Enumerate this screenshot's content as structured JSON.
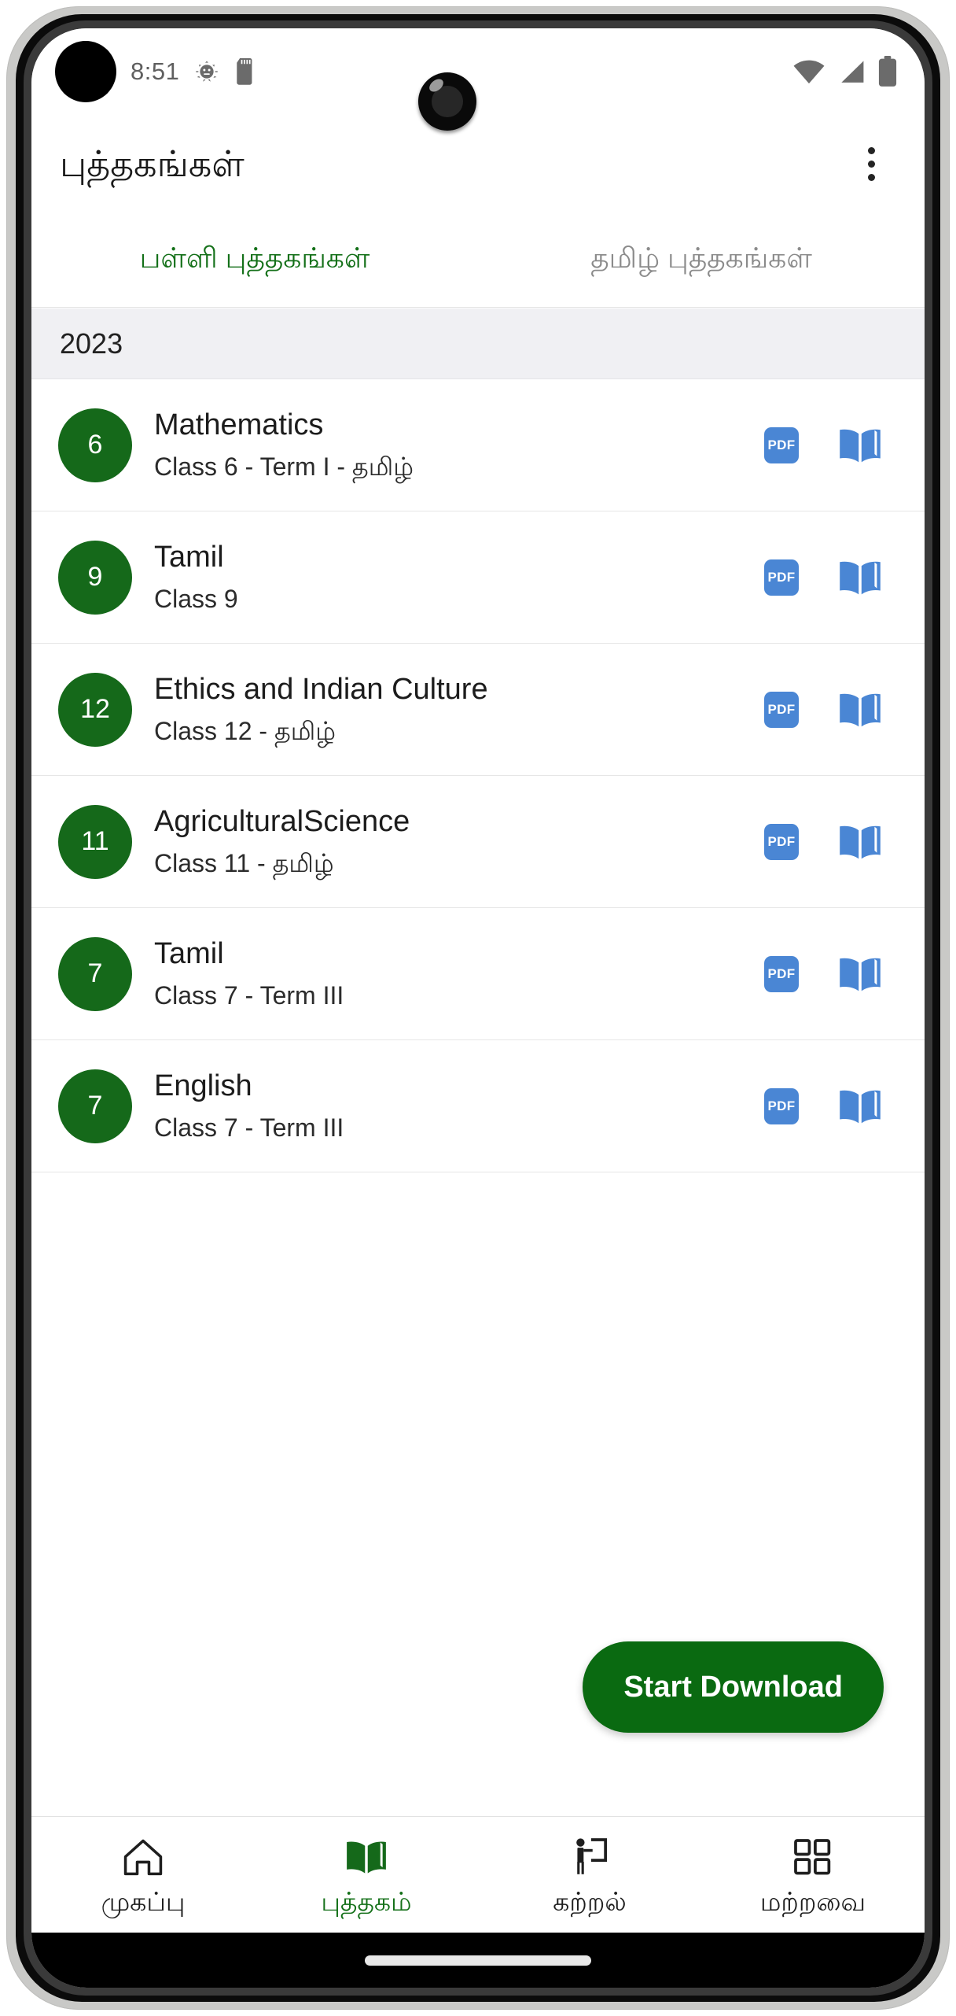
{
  "status_bar": {
    "time": "8:51",
    "left_icons": [
      "android-gear-icon",
      "sd-card-icon"
    ],
    "right_icons": [
      "wifi-icon",
      "cellular-signal-icon",
      "battery-icon"
    ]
  },
  "app_bar": {
    "title": "புத்தகங்கள்",
    "overflow_label": "overflow-menu"
  },
  "tabs": [
    {
      "label": "பள்ளி புத்தகங்கள்",
      "active": true
    },
    {
      "label": "தமிழ் புத்தகங்கள்",
      "active": false
    }
  ],
  "section": {
    "year": "2023"
  },
  "books": [
    {
      "class_number": "6",
      "title": "Mathematics",
      "subtitle": "Class 6 - Term I - தமிழ்",
      "pdf_label": "PDF",
      "read_icon": "open-book-icon"
    },
    {
      "class_number": "9",
      "title": "Tamil",
      "subtitle": "Class 9",
      "pdf_label": "PDF",
      "read_icon": "open-book-icon"
    },
    {
      "class_number": "12",
      "title": "Ethics and Indian Culture",
      "subtitle": "Class 12 - தமிழ்",
      "pdf_label": "PDF",
      "read_icon": "open-book-icon"
    },
    {
      "class_number": "11",
      "title": "AgriculturalScience",
      "subtitle": "Class 11 - தமிழ்",
      "pdf_label": "PDF",
      "read_icon": "open-book-icon"
    },
    {
      "class_number": "7",
      "title": "Tamil",
      "subtitle": "Class 7 - Term III",
      "pdf_label": "PDF",
      "read_icon": "open-book-icon"
    },
    {
      "class_number": "7",
      "title": "English",
      "subtitle": "Class 7 - Term III",
      "pdf_label": "PDF",
      "read_icon": "open-book-icon"
    }
  ],
  "primary_action": {
    "label": "Start Download"
  },
  "bottom_nav": [
    {
      "label": "முகப்பு",
      "icon": "home-icon",
      "active": false
    },
    {
      "label": "புத்தகம்",
      "icon": "book-icon",
      "active": true
    },
    {
      "label": "கற்றல்",
      "icon": "teaching-icon",
      "active": false
    },
    {
      "label": "மற்றவை",
      "icon": "grid-icon",
      "active": false
    }
  ],
  "colors": {
    "brand_green": "#15691a",
    "accent_blue": "#4a86d4",
    "section_bg": "#f0f0f3",
    "text_primary": "#1c1c1c",
    "text_muted": "#8b8b8b"
  }
}
